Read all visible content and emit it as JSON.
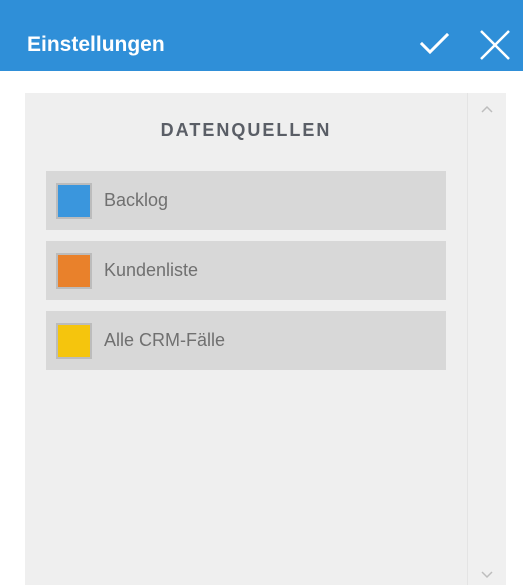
{
  "header": {
    "title": "Einstellungen",
    "confirm_icon": "checkmark-icon",
    "close_icon": "close-icon"
  },
  "panel": {
    "title": "DATENQUELLEN"
  },
  "data_sources": [
    {
      "label": "Backlog",
      "color": "#3a96dd"
    },
    {
      "label": "Kundenliste",
      "color": "#e9812b"
    },
    {
      "label": "Alle CRM-Fälle",
      "color": "#f5c50d"
    }
  ],
  "colors": {
    "header_background": "#2f8fd8",
    "panel_background": "#efefef",
    "item_background": "#d8d8d8"
  }
}
